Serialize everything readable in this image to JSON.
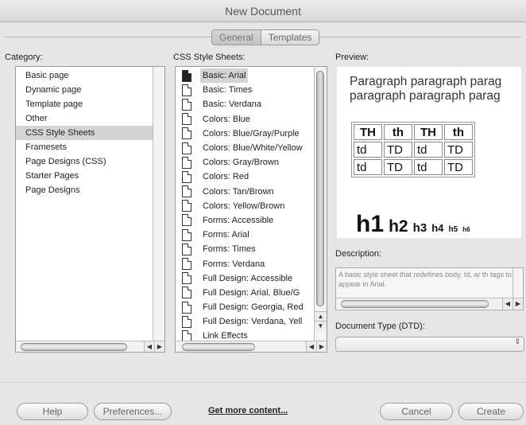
{
  "window": {
    "title": "New Document"
  },
  "tabs": [
    {
      "label": "General",
      "active": true
    },
    {
      "label": "Templates",
      "active": false
    }
  ],
  "category": {
    "label": "Category:",
    "items": [
      "Basic page",
      "Dynamic page",
      "Template page",
      "Other",
      "CSS Style Sheets",
      "Framesets",
      "Page Designs (CSS)",
      "Starter Pages",
      "Page Designs"
    ],
    "selected": "CSS Style Sheets"
  },
  "css_sheets": {
    "label": "CSS Style Sheets:",
    "items": [
      "Basic: Arial",
      "Basic: Times",
      "Basic: Verdana",
      "Colors: Blue",
      "Colors: Blue/Gray/Purple",
      "Colors: Blue/White/Yellow",
      "Colors: Gray/Brown",
      "Colors: Red",
      "Colors: Tan/Brown",
      "Colors: Yellow/Brown",
      "Forms: Accessible",
      "Forms: Arial",
      "Forms: Times",
      "Forms: Verdana",
      "Full Design: Accessible",
      "Full Design: Arial, Blue/G",
      "Full Design: Georgia, Red",
      "Full Design: Verdana, Yell",
      "Link Effects"
    ],
    "selected": "Basic: Arial"
  },
  "preview": {
    "label": "Preview:",
    "paragraph_lines": [
      "Paragraph paragraph parag",
      "paragraph paragraph parag"
    ],
    "table": {
      "headers": [
        "TH",
        "th",
        "TH",
        "th"
      ],
      "rows": [
        [
          "td",
          "TD",
          "td",
          "TD"
        ],
        [
          "td",
          "TD",
          "td",
          "TD"
        ]
      ]
    },
    "headings": [
      "h1",
      "h2",
      "h3",
      "h4",
      "h5",
      "h6"
    ]
  },
  "description": {
    "label": "Description:",
    "text": "A basic style sheet that redefines body, td, ar th tags to appear in Arial."
  },
  "doctype": {
    "label": "Document Type (DTD):",
    "value": ""
  },
  "buttons": {
    "help": "Help",
    "preferences": "Preferences...",
    "get_more": "Get more content...",
    "cancel": "Cancel",
    "create": "Create"
  },
  "icons": {
    "scroll_left": "◀",
    "scroll_right": "▶",
    "scroll_up": "▲",
    "scroll_down": "▼",
    "select_chevron": "⇕"
  }
}
